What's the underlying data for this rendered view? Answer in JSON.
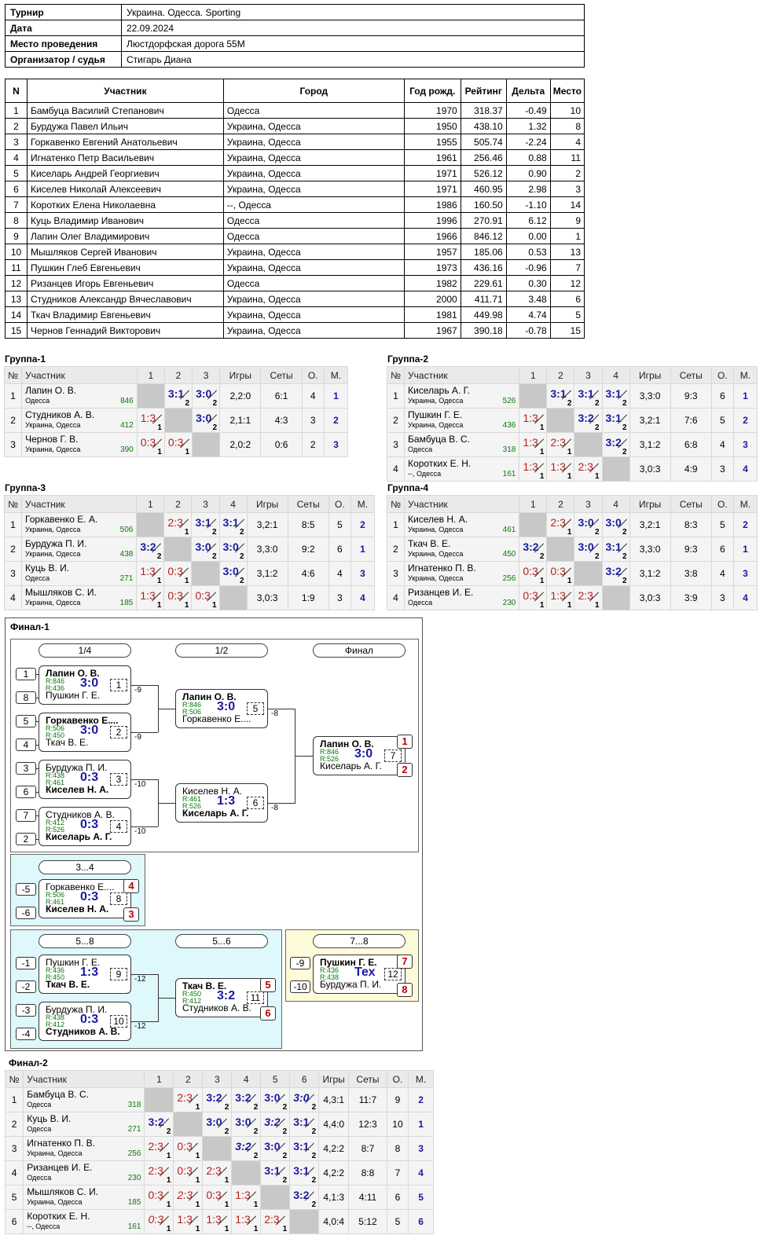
{
  "info": [
    [
      "Турнир",
      "Украина. Одесса. Sporting"
    ],
    [
      "Дата",
      "22.09.2024"
    ],
    [
      "Место проведения",
      "Люстдорфская дорога 55М"
    ],
    [
      "Организатор / судья",
      "Стигарь Диана"
    ]
  ],
  "main_headers": [
    "N",
    "Участник",
    "Город",
    "Год рожд.",
    "Рейтинг",
    "Дельта",
    "Место"
  ],
  "players": [
    [
      "1",
      "Бамбуца Василий Степанович",
      "Одесса",
      "1970",
      "318.37",
      "-0.49",
      "10"
    ],
    [
      "2",
      "Бурдужа Павел Ильич",
      "Украина, Одесса",
      "1950",
      "438.10",
      "1.32",
      "8"
    ],
    [
      "3",
      "Горкавенко Евгений Анатольевич",
      "Украина, Одесса",
      "1955",
      "505.74",
      "-2.24",
      "4"
    ],
    [
      "4",
      "Игнатенко Петр Васильевич",
      "Украина, Одесса",
      "1961",
      "256.46",
      "0.88",
      "11"
    ],
    [
      "5",
      "Киселарь Андрей Георгиевич",
      "Украина, Одесса",
      "1971",
      "526.12",
      "0.90",
      "2"
    ],
    [
      "6",
      "Киселев Николай Алексеевич",
      "Украина, Одесса",
      "1971",
      "460.95",
      "2.98",
      "3"
    ],
    [
      "7",
      "Коротких Елена Николаевна",
      "--, Одесса",
      "1986",
      "160.50",
      "-1.10",
      "14"
    ],
    [
      "8",
      "Куць Владимир Иванович",
      "Одесса",
      "1996",
      "270.91",
      "6.12",
      "9"
    ],
    [
      "9",
      "Лапин Олег Владимирович",
      "Одесса",
      "1966",
      "846.12",
      "0.00",
      "1"
    ],
    [
      "10",
      "Мышляков Сергей Иванович",
      "Украина, Одесса",
      "1957",
      "185.06",
      "0.53",
      "13"
    ],
    [
      "11",
      "Пушкин Глеб Евгеньевич",
      "Украина, Одесса",
      "1973",
      "436.16",
      "-0.96",
      "7"
    ],
    [
      "12",
      "Ризанцев Игорь Евгеньевич",
      "Одесса",
      "1982",
      "229.61",
      "0.30",
      "12"
    ],
    [
      "13",
      "Студников Александр Вячеславович",
      "Украина, Одесса",
      "2000",
      "411.71",
      "3.48",
      "6"
    ],
    [
      "14",
      "Ткач Владимир Евгеньевич",
      "Украина, Одесса",
      "1981",
      "449.98",
      "4.74",
      "5"
    ],
    [
      "15",
      "Чернов Геннадий Викторович",
      "Украина, Одесса",
      "1967",
      "390.18",
      "-0.78",
      "15"
    ]
  ],
  "group_headers": {
    "n": "№",
    "name": "Участник",
    "games": "Игры",
    "sets": "Сеты",
    "pts": "О.",
    "place": "М."
  },
  "groups": [
    {
      "title": "Группа-1",
      "rows": [
        {
          "n": "1",
          "name": "Лапин О. В.",
          "city": "Одесса",
          "rating": "846",
          "scores": [
            null,
            [
              "3:1",
              "2",
              "w"
            ],
            [
              "3:0",
              "2",
              "w"
            ]
          ],
          "games": "2,2:0",
          "sets": "6:1",
          "pts": "4",
          "place": "1"
        },
        {
          "n": "2",
          "name": "Студников А. В.",
          "city": "Украина, Одесса",
          "rating": "412",
          "scores": [
            [
              "1:3",
              "1",
              "l"
            ],
            null,
            [
              "3:0",
              "2",
              "w"
            ]
          ],
          "games": "2,1:1",
          "sets": "4:3",
          "pts": "3",
          "place": "2"
        },
        {
          "n": "3",
          "name": "Чернов Г. В.",
          "city": "Украина, Одесса",
          "rating": "390",
          "scores": [
            [
              "0:3",
              "1",
              "l"
            ],
            [
              "0:3",
              "1",
              "l"
            ],
            null
          ],
          "games": "2,0:2",
          "sets": "0:6",
          "pts": "2",
          "place": "3"
        }
      ]
    },
    {
      "title": "Группа-2",
      "rows": [
        {
          "n": "1",
          "name": "Киселарь А. Г.",
          "city": "Украина, Одесса",
          "rating": "526",
          "scores": [
            null,
            [
              "3:1",
              "2",
              "w"
            ],
            [
              "3:1",
              "2",
              "w"
            ],
            [
              "3:1",
              "2",
              "w"
            ]
          ],
          "games": "3,3:0",
          "sets": "9:3",
          "pts": "6",
          "place": "1"
        },
        {
          "n": "2",
          "name": "Пушкин Г. Е.",
          "city": "Украина, Одесса",
          "rating": "436",
          "scores": [
            [
              "1:3",
              "1",
              "l"
            ],
            null,
            [
              "3:2",
              "2",
              "w"
            ],
            [
              "3:1",
              "2",
              "w"
            ]
          ],
          "games": "3,2:1",
          "sets": "7:6",
          "pts": "5",
          "place": "2"
        },
        {
          "n": "3",
          "name": "Бамбуца В. С.",
          "city": "Одесса",
          "rating": "318",
          "scores": [
            [
              "1:3",
              "1",
              "l"
            ],
            [
              "2:3",
              "1",
              "l"
            ],
            null,
            [
              "3:2",
              "2",
              "w"
            ]
          ],
          "games": "3,1:2",
          "sets": "6:8",
          "pts": "4",
          "place": "3"
        },
        {
          "n": "4",
          "name": "Коротких Е. Н.",
          "city": "--, Одесса",
          "rating": "161",
          "scores": [
            [
              "1:3",
              "1",
              "l"
            ],
            [
              "1:3",
              "1",
              "l"
            ],
            [
              "2:3",
              "1",
              "l"
            ],
            null
          ],
          "games": "3,0:3",
          "sets": "4:9",
          "pts": "3",
          "place": "4"
        }
      ]
    },
    {
      "title": "Группа-3",
      "rows": [
        {
          "n": "1",
          "name": "Горкавенко Е. А.",
          "city": "Украина, Одесса",
          "rating": "506",
          "scores": [
            null,
            [
              "2:3",
              "1",
              "l"
            ],
            [
              "3:1",
              "2",
              "w"
            ],
            [
              "3:1",
              "2",
              "w"
            ]
          ],
          "games": "3,2:1",
          "sets": "8:5",
          "pts": "5",
          "place": "2"
        },
        {
          "n": "2",
          "name": "Бурдужа П. И.",
          "city": "Украина, Одесса",
          "rating": "438",
          "scores": [
            [
              "3:2",
              "2",
              "w"
            ],
            null,
            [
              "3:0",
              "2",
              "w"
            ],
            [
              "3:0",
              "2",
              "w"
            ]
          ],
          "games": "3,3:0",
          "sets": "9:2",
          "pts": "6",
          "place": "1"
        },
        {
          "n": "3",
          "name": "Куць В. И.",
          "city": "Одесса",
          "rating": "271",
          "scores": [
            [
              "1:3",
              "1",
              "l"
            ],
            [
              "0:3",
              "1",
              "l"
            ],
            null,
            [
              "3:0",
              "2",
              "w"
            ]
          ],
          "games": "3,1:2",
          "sets": "4:6",
          "pts": "4",
          "place": "3"
        },
        {
          "n": "4",
          "name": "Мышляков С. И.",
          "city": "Украина, Одесса",
          "rating": "185",
          "scores": [
            [
              "1:3",
              "1",
              "l"
            ],
            [
              "0:3",
              "1",
              "l"
            ],
            [
              "0:3",
              "1",
              "l"
            ],
            null
          ],
          "games": "3,0:3",
          "sets": "1:9",
          "pts": "3",
          "place": "4"
        }
      ]
    },
    {
      "title": "Группа-4",
      "rows": [
        {
          "n": "1",
          "name": "Киселев Н. А.",
          "city": "Украина, Одесса",
          "rating": "461",
          "scores": [
            null,
            [
              "2:3",
              "1",
              "l"
            ],
            [
              "3:0",
              "2",
              "w"
            ],
            [
              "3:0",
              "2",
              "w"
            ]
          ],
          "games": "3,2:1",
          "sets": "8:3",
          "pts": "5",
          "place": "2"
        },
        {
          "n": "2",
          "name": "Ткач В. Е.",
          "city": "Украина, Одесса",
          "rating": "450",
          "scores": [
            [
              "3:2",
              "2",
              "w"
            ],
            null,
            [
              "3:0",
              "2",
              "w"
            ],
            [
              "3:1",
              "2",
              "w"
            ]
          ],
          "games": "3,3:0",
          "sets": "9:3",
          "pts": "6",
          "place": "1"
        },
        {
          "n": "3",
          "name": "Игнатенко П. В.",
          "city": "Украина, Одесса",
          "rating": "256",
          "scores": [
            [
              "0:3",
              "1",
              "l"
            ],
            [
              "0:3",
              "1",
              "l"
            ],
            null,
            [
              "3:2",
              "2",
              "w"
            ]
          ],
          "games": "3,1:2",
          "sets": "3:8",
          "pts": "4",
          "place": "3"
        },
        {
          "n": "4",
          "name": "Ризанцев И. Е.",
          "city": "Одесса",
          "rating": "230",
          "scores": [
            [
              "0:3",
              "1",
              "l"
            ],
            [
              "1:3",
              "1",
              "l"
            ],
            [
              "2:3",
              "1",
              "l"
            ],
            null
          ],
          "games": "3,0:3",
          "sets": "3:9",
          "pts": "3",
          "place": "4"
        }
      ]
    }
  ],
  "final1": {
    "title": "Финал-1",
    "labels": {
      "r14": "1/4",
      "r12": "1/2",
      "rf": "Финал",
      "r34": "3...4",
      "r58": "5...8",
      "r56": "5...6",
      "r78": "7...8"
    },
    "seeds": [
      "1",
      "8",
      "5",
      "4",
      "3",
      "6",
      "7",
      "2",
      "-5",
      "-6",
      "-1",
      "-2",
      "-3",
      "-4",
      "-9",
      "-10"
    ],
    "losers": [
      "-9",
      "-9",
      "-10",
      "-10",
      "-8",
      "-8",
      "-12",
      "-12"
    ],
    "matches": [
      {
        "a": "Лапин О. В.",
        "b": "Пушкин Г. Е.",
        "ra": "R:846",
        "rb": "R:436",
        "s": "3:0",
        "n": "1",
        "win": "a"
      },
      {
        "a": "Горкавенко Е....",
        "b": "Ткач В. Е.",
        "ra": "R:506",
        "rb": "R:450",
        "s": "3:0",
        "n": "2",
        "win": "a"
      },
      {
        "a": "Бурдужа П. И.",
        "b": "Киселев Н. А.",
        "ra": "R:438",
        "rb": "R:461",
        "s": "0:3",
        "n": "3",
        "win": "b"
      },
      {
        "a": "Студников А. В.",
        "b": "Киселарь А. Г.",
        "ra": "R:412",
        "rb": "R:526",
        "s": "0:3",
        "n": "4",
        "win": "b"
      },
      {
        "a": "Лапин О. В.",
        "b": "Горкавенко Е....",
        "ra": "R:846",
        "rb": "R:506",
        "s": "3:0",
        "n": "5",
        "win": "a"
      },
      {
        "a": "Киселев Н. А.",
        "b": "Киселарь А. Г.",
        "ra": "R:461",
        "rb": "R:526",
        "s": "1:3",
        "n": "6",
        "win": "b"
      },
      {
        "a": "Лапин О. В.",
        "b": "Киселарь А. Г.",
        "ra": "R:846",
        "rb": "R:526",
        "s": "3:0",
        "n": "7",
        "win": "a"
      },
      {
        "a": "Горкавенко Е....",
        "b": "Киселев Н. А.",
        "ra": "R:506",
        "rb": "R:461",
        "s": "0:3",
        "n": "8",
        "win": "b"
      },
      {
        "a": "Пушкин Г. Е.",
        "b": "Ткач В. Е.",
        "ra": "R:436",
        "rb": "R:450",
        "s": "1:3",
        "n": "9",
        "win": "b"
      },
      {
        "a": "Бурдужа П. И.",
        "b": "Студников А. В.",
        "ra": "R:438",
        "rb": "R:412",
        "s": "0:3",
        "n": "10",
        "win": "b"
      },
      {
        "a": "Ткач В. Е.",
        "b": "Студников А. В.",
        "ra": "R:450",
        "rb": "R:412",
        "s": "3:2",
        "n": "11",
        "win": "a"
      },
      {
        "a": "Пушкин Г. Е.",
        "b": "Бурдужа П. И.",
        "ra": "R:436",
        "rb": "R:438",
        "s": "Тех",
        "n": "12",
        "win": "a"
      }
    ],
    "places": [
      "1",
      "2",
      "4",
      "3",
      "5",
      "6",
      "7",
      "8"
    ]
  },
  "final2": {
    "title": "Финал-2",
    "rows": [
      {
        "n": "1",
        "name": "Бамбуца В. С.",
        "city": "Одесса",
        "rating": "318",
        "scores": [
          null,
          [
            "2:3",
            "1",
            "l"
          ],
          [
            "3:2",
            "2",
            "w"
          ],
          [
            "3:2",
            "2",
            "w"
          ],
          [
            "3:0",
            "2",
            "w"
          ],
          [
            "3:0",
            "2",
            "wi"
          ]
        ],
        "games": "4,3:1",
        "sets": "11:7",
        "pts": "9",
        "place": "2"
      },
      {
        "n": "2",
        "name": "Куць В. И.",
        "city": "Одесса",
        "rating": "271",
        "scores": [
          [
            "3:2",
            "2",
            "w"
          ],
          null,
          [
            "3:0",
            "2",
            "w"
          ],
          [
            "3:0",
            "2",
            "w"
          ],
          [
            "3:2",
            "2",
            "wi"
          ],
          [
            "3:1",
            "2",
            "w"
          ]
        ],
        "games": "4,4:0",
        "sets": "12:3",
        "pts": "10",
        "place": "1"
      },
      {
        "n": "3",
        "name": "Игнатенко П. В.",
        "city": "Украина, Одесса",
        "rating": "256",
        "scores": [
          [
            "2:3",
            "1",
            "l"
          ],
          [
            "0:3",
            "1",
            "l"
          ],
          null,
          [
            "3:2",
            "2",
            "wi"
          ],
          [
            "3:0",
            "2",
            "w"
          ],
          [
            "3:1",
            "2",
            "w"
          ]
        ],
        "games": "4,2:2",
        "sets": "8:7",
        "pts": "8",
        "place": "3"
      },
      {
        "n": "4",
        "name": "Ризанцев И. Е.",
        "city": "Одесса",
        "rating": "230",
        "scores": [
          [
            "2:3",
            "1",
            "l"
          ],
          [
            "0:3",
            "1",
            "l"
          ],
          [
            "2:3",
            "1",
            "l"
          ],
          null,
          [
            "3:1",
            "2",
            "w"
          ],
          [
            "3:1",
            "2",
            "w"
          ]
        ],
        "games": "4,2:2",
        "sets": "8:8",
        "pts": "7",
        "place": "4"
      },
      {
        "n": "5",
        "name": "Мышляков С. И.",
        "city": "Украина, Одесса",
        "rating": "185",
        "scores": [
          [
            "0:3",
            "1",
            "l"
          ],
          [
            "2:3",
            "1",
            "li"
          ],
          [
            "0:3",
            "1",
            "l"
          ],
          [
            "1:3",
            "1",
            "l"
          ],
          null,
          [
            "3:2",
            "2",
            "w"
          ]
        ],
        "games": "4,1:3",
        "sets": "4:11",
        "pts": "6",
        "place": "5"
      },
      {
        "n": "6",
        "name": "Коротких Е. Н.",
        "city": "--, Одесса",
        "rating": "161",
        "scores": [
          [
            "0:3",
            "1",
            "li"
          ],
          [
            "1:3",
            "1",
            "l"
          ],
          [
            "1:3",
            "1",
            "l"
          ],
          [
            "1:3",
            "1",
            "l"
          ],
          [
            "2:3",
            "1",
            "l"
          ],
          null
        ],
        "games": "4,0:4",
        "sets": "5:12",
        "pts": "5",
        "place": "6"
      }
    ]
  }
}
